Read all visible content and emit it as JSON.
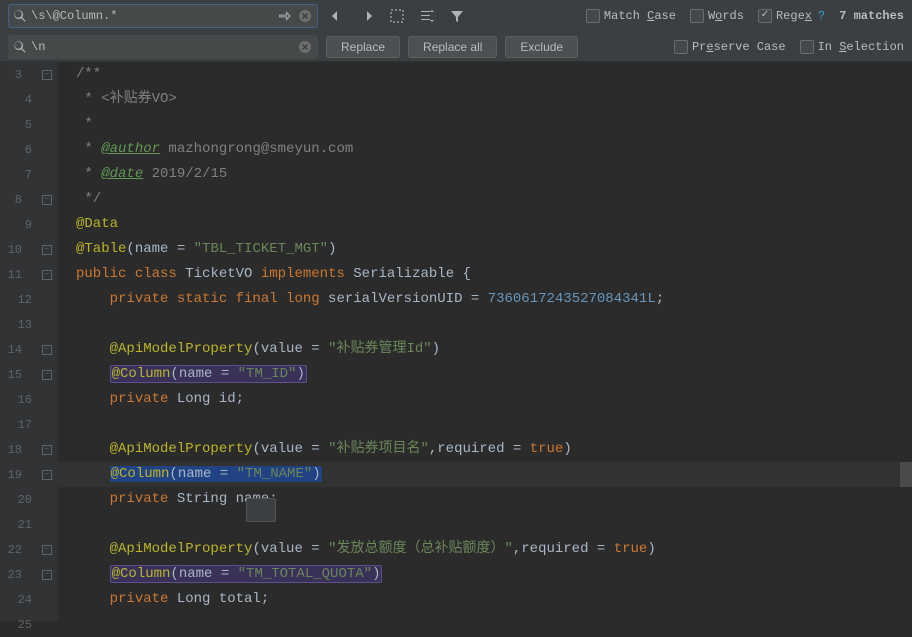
{
  "search": {
    "find_value": "\\s\\@Column.*",
    "replace_value": "\\n",
    "match_count": "7 matches"
  },
  "labels": {
    "match_case": "Match Case",
    "words": "Words",
    "regex": "Regex",
    "preserve_case": "Preserve Case",
    "in_selection": "In Selection",
    "replace": "Replace",
    "replace_all": "Replace all",
    "exclude": "Exclude"
  },
  "checkboxes": {
    "match_case": false,
    "words": false,
    "regex": true,
    "preserve_case": false,
    "in_selection": false
  },
  "chart_data": {
    "type": "table",
    "title": "Java Source Code Editor",
    "columns": [
      "line_number",
      "code"
    ],
    "rows": [
      [
        3,
        "/**"
      ],
      [
        4,
        " * <补贴券VO>"
      ],
      [
        5,
        " *"
      ],
      [
        6,
        " * @author mazhongrong@smeyun.com"
      ],
      [
        7,
        " * @date 2019/2/15"
      ],
      [
        8,
        " */"
      ],
      [
        9,
        "@Data"
      ],
      [
        10,
        "@Table(name = \"TBL_TICKET_MGT\")"
      ],
      [
        11,
        "public class TicketVO implements Serializable {"
      ],
      [
        12,
        "    private static final long serialVersionUID = 7360617243527084341L;"
      ],
      [
        13,
        ""
      ],
      [
        14,
        "    @ApiModelProperty(value = \"补贴券管理Id\")"
      ],
      [
        15,
        "    @Column(name = \"TM_ID\")"
      ],
      [
        16,
        "    private Long id;"
      ],
      [
        17,
        ""
      ],
      [
        18,
        "    @ApiModelProperty(value = \"补贴券项目名\",required = true)"
      ],
      [
        19,
        "    @Column(name = \"TM_NAME\")"
      ],
      [
        20,
        "    private String name;"
      ],
      [
        21,
        ""
      ],
      [
        22,
        "    @ApiModelProperty(value = \"发放总额度（总补贴额度）\",required = true)"
      ],
      [
        23,
        "    @Column(name = \"TM_TOTAL_QUOTA\")"
      ],
      [
        24,
        "    private Long total;"
      ],
      [
        25,
        ""
      ]
    ]
  },
  "code": {
    "l3": "/**",
    "l4_p": " * <补贴券VO>",
    "l5": " *",
    "l6_p": " * ",
    "l6_tag": "@author",
    "l6_txt": " mazhongrong@smeyun.com",
    "l7_p": " * ",
    "l7_tag": "@date",
    "l7_txt": " 2019/2/15",
    "l8": " */",
    "l9": "@Data",
    "l10_a": "@Table",
    "l10_b": "(name = ",
    "l10_c": "\"TBL_TICKET_MGT\"",
    "l10_d": ")",
    "l11_a": "public",
    "l11_b": " class",
    "l11_c": " TicketVO ",
    "l11_d": "implements",
    "l11_e": " Serializable {",
    "l12_a": "    ",
    "l12_b": "private static final long",
    "l12_c": " serialVersionUID = ",
    "l12_d": "7360617243527084341L",
    "l12_e": ";",
    "l14_a": "    ",
    "l14_b": "@ApiModelProperty",
    "l14_c": "(value = ",
    "l14_d": "\"补贴券管理Id\"",
    "l14_e": ")",
    "l15_a": "    ",
    "l15_b": "@Column",
    "l15_c": "(name = ",
    "l15_d": "\"TM_ID\"",
    "l15_e": ")",
    "l16_a": "    ",
    "l16_b": "private",
    "l16_c": " Long id;",
    "l18_a": "    ",
    "l18_b": "@ApiModelProperty",
    "l18_c": "(value = ",
    "l18_d": "\"补贴券项目名\"",
    "l18_e": ",required = ",
    "l18_f": "true",
    "l18_g": ")",
    "l19_a": "    ",
    "l19_b": "@Column",
    "l19_c": "(name = ",
    "l19_d": "\"TM_NAME\"",
    "l19_e": ")",
    "l20_a": "    ",
    "l20_b": "private",
    "l20_c": " String name;",
    "l22_a": "    ",
    "l22_b": "@ApiModelProperty",
    "l22_c": "(value = ",
    "l22_d": "\"发放总额度（总补贴额度）\"",
    "l22_e": ",required = ",
    "l22_f": "true",
    "l22_g": ")",
    "l23_a": "    ",
    "l23_b": "@Column",
    "l23_c": "(name = ",
    "l23_d": "\"TM_TOTAL_QUOTA\"",
    "l23_e": ")",
    "l24_a": "    ",
    "l24_b": "private",
    "l24_c": " Long total;"
  },
  "line_numbers": [
    "3",
    "4",
    "5",
    "6",
    "7",
    "8",
    "9",
    "10",
    "11",
    "12",
    "13",
    "14",
    "15",
    "16",
    "17",
    "18",
    "19",
    "20",
    "21",
    "22",
    "23",
    "24",
    "25"
  ]
}
